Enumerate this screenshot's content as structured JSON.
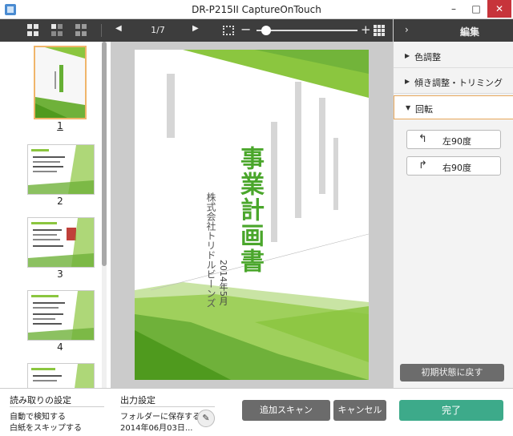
{
  "window": {
    "title": "DR-P215II CaptureOnTouch",
    "minimize_glyph": "–",
    "maximize_glyph": "□",
    "close_glyph": "✕"
  },
  "toolbar": {
    "page_indicator": "1/7",
    "zoom_level": 0.05,
    "icons": [
      "grid-large-icon",
      "grid-medium-icon",
      "grid-small-icon",
      "prev-page-icon",
      "next-page-icon",
      "fit-page-icon",
      "zoom-out-icon",
      "zoom-in-icon",
      "thumbnail-grid-icon"
    ],
    "prev_glyph": "◀",
    "next_glyph": "▶",
    "minus_glyph": "−",
    "plus_glyph": "+"
  },
  "thumbnails": {
    "pages": [
      {
        "number": "1",
        "selected": true
      },
      {
        "number": "2",
        "selected": false
      },
      {
        "number": "3",
        "selected": false
      },
      {
        "number": "4",
        "selected": false
      }
    ]
  },
  "preview": {
    "main_title": "事業計画書",
    "date": "2014年5月",
    "company": "株式会社トリドルビーンズ",
    "accent_color": "#8bc63f",
    "dark_accent": "#4f9a1e"
  },
  "panel": {
    "collapse_glyph": "›",
    "title": "編集",
    "sections": [
      {
        "label": "色調整",
        "arrow": "▶"
      },
      {
        "label": "傾き調整・トリミング",
        "arrow": "▶"
      },
      {
        "label": "回転",
        "arrow": "▼"
      }
    ],
    "rotate_left": "左90度",
    "rotate_right": "右90度",
    "rotate_left_glyph": "↰",
    "rotate_right_glyph": "↱",
    "reset": "初期状態に戻す"
  },
  "bottom": {
    "scan_settings_title": "読み取りの設定",
    "scan_setting_1": "自動で検知する",
    "scan_setting_2": "白紙をスキップする",
    "output_settings_title": "出力設定",
    "output_setting_1": "フォルダーに保存する",
    "output_setting_2": "2014年06月03日...",
    "edit_glyph": "✎",
    "add_scan": "追加スキャン",
    "cancel": "キャンセル",
    "done": "完了"
  },
  "colors": {
    "toolbar_bg": "#3d3d3d",
    "done_green": "#3daa8a",
    "selection_orange": "#f0b56a",
    "close_red": "#c7343b"
  }
}
